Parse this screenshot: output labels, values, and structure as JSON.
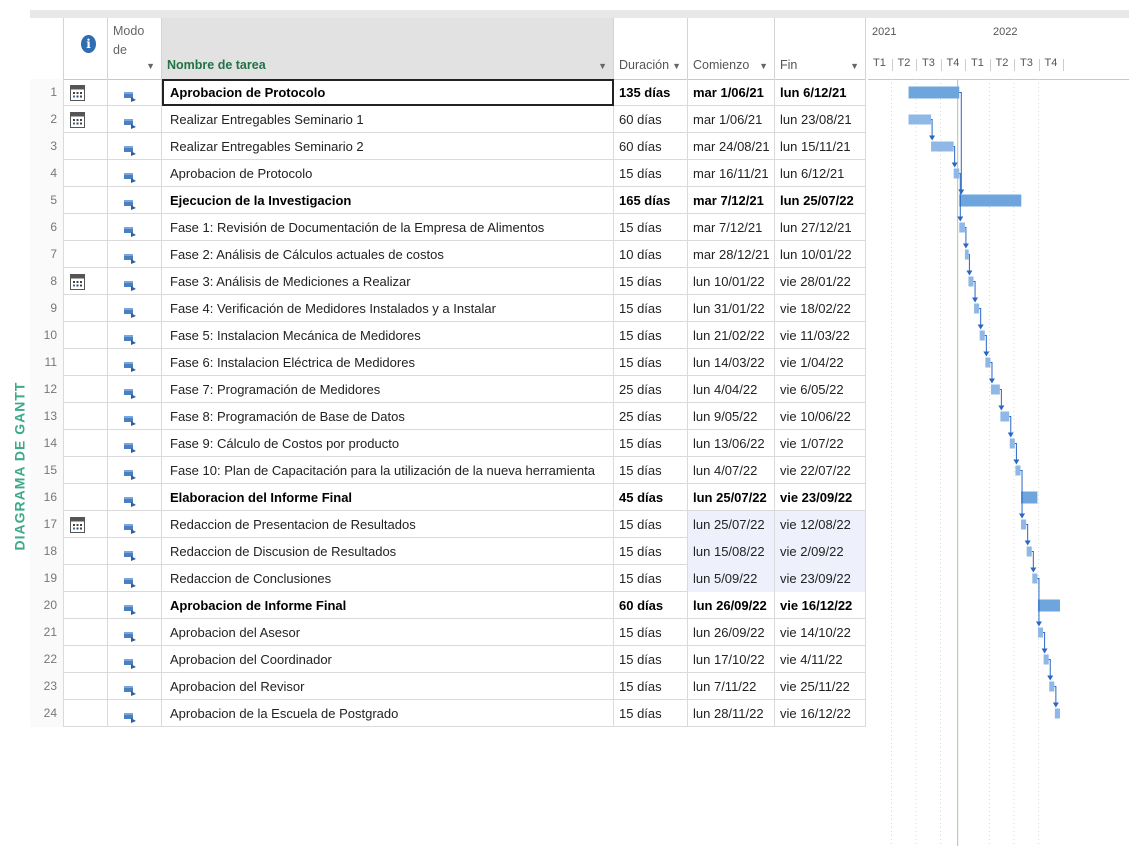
{
  "side_label": "DIAGRAMA DE GANTT",
  "header": {
    "info_icon": "info-icon",
    "modo_line1": "Modo",
    "modo_line2": "de",
    "task_name": "Nombre de tarea",
    "duration": "Duración",
    "start": "Comienzo",
    "finish": "Fin"
  },
  "timescale": {
    "years": [
      "2021",
      "2022"
    ],
    "quarters": [
      "T1",
      "T2",
      "T3",
      "T4",
      "T1",
      "T2",
      "T3",
      "T4"
    ]
  },
  "colors": {
    "bar": "#8fb8e6",
    "summary_bar": "#6fa5dd",
    "link": "#2a66c4",
    "today_line": "#9ccf9c",
    "side_label": "#3eaa8a",
    "task_header_text": "#217346"
  },
  "tasks": [
    {
      "id": "1",
      "cal": true,
      "summary": true,
      "name": "Aprobacion de Protocolo",
      "duration": "135 días",
      "start": "mar 1/06/21",
      "finish": "lun 6/12/21"
    },
    {
      "id": "2",
      "cal": true,
      "summary": false,
      "name": "Realizar Entregables Seminario 1",
      "duration": "60 días",
      "start": "mar 1/06/21",
      "finish": "lun 23/08/21"
    },
    {
      "id": "3",
      "cal": false,
      "summary": false,
      "name": "Realizar Entregables Seminario 2",
      "duration": "60 días",
      "start": "mar 24/08/21",
      "finish": "lun 15/11/21"
    },
    {
      "id": "4",
      "cal": false,
      "summary": false,
      "name": "Aprobacion de Protocolo",
      "duration": "15 días",
      "start": "mar 16/11/21",
      "finish": "lun 6/12/21"
    },
    {
      "id": "5",
      "cal": false,
      "summary": true,
      "name": "Ejecucion de la Investigacion",
      "duration": "165 días",
      "start": "mar 7/12/21",
      "finish": "lun 25/07/22"
    },
    {
      "id": "6",
      "cal": false,
      "summary": false,
      "name": "Fase 1: Revisión de Documentación de la Empresa de Alimentos",
      "duration": "15 días",
      "start": "mar 7/12/21",
      "finish": "lun 27/12/21"
    },
    {
      "id": "7",
      "cal": false,
      "summary": false,
      "name": "Fase 2: Análisis de Cálculos actuales de costos",
      "duration": "10 días",
      "start": "mar 28/12/21",
      "finish": "lun 10/01/22"
    },
    {
      "id": "8",
      "cal": true,
      "summary": false,
      "name": "Fase 3: Análisis de Mediciones a Realizar",
      "duration": "15 días",
      "start": "lun 10/01/22",
      "finish": "vie 28/01/22"
    },
    {
      "id": "9",
      "cal": false,
      "summary": false,
      "name": "Fase 4: Verificación de Medidores Instalados y a Instalar",
      "duration": "15 días",
      "start": "lun 31/01/22",
      "finish": "vie 18/02/22"
    },
    {
      "id": "10",
      "cal": false,
      "summary": false,
      "name": "Fase 5: Instalacion Mecánica de Medidores",
      "duration": "15 días",
      "start": "lun 21/02/22",
      "finish": "vie 11/03/22"
    },
    {
      "id": "11",
      "cal": false,
      "summary": false,
      "name": "Fase 6: Instalacion Eléctrica de Medidores",
      "duration": "15 días",
      "start": "lun 14/03/22",
      "finish": "vie 1/04/22"
    },
    {
      "id": "12",
      "cal": false,
      "summary": false,
      "name": "Fase 7: Programación de Medidores",
      "duration": "25 días",
      "start": "lun 4/04/22",
      "finish": "vie 6/05/22"
    },
    {
      "id": "13",
      "cal": false,
      "summary": false,
      "name": "Fase 8: Programación de Base de Datos",
      "duration": "25 días",
      "start": "lun 9/05/22",
      "finish": "vie 10/06/22"
    },
    {
      "id": "14",
      "cal": false,
      "summary": false,
      "name": "Fase 9: Cálculo de Costos por producto",
      "duration": "15 días",
      "start": "lun 13/06/22",
      "finish": "vie 1/07/22"
    },
    {
      "id": "15",
      "cal": false,
      "summary": false,
      "name": "Fase 10: Plan de Capacitación para la utilización de la nueva herramienta",
      "duration": "15 días",
      "start": "lun 4/07/22",
      "finish": "vie 22/07/22"
    },
    {
      "id": "16",
      "cal": false,
      "summary": true,
      "name": "Elaboracion del Informe Final",
      "duration": "45 días",
      "start": "lun 25/07/22",
      "finish": "vie 23/09/22"
    },
    {
      "id": "17",
      "cal": true,
      "summary": false,
      "name": "Redaccion de Presentacion de Resultados",
      "duration": "15 días",
      "start": "lun 25/07/22",
      "finish": "vie 12/08/22",
      "hl": true
    },
    {
      "id": "18",
      "cal": false,
      "summary": false,
      "name": "Redaccion de Discusion de Resultados",
      "duration": "15 días",
      "start": "lun 15/08/22",
      "finish": "vie 2/09/22",
      "hl": true
    },
    {
      "id": "19",
      "cal": false,
      "summary": false,
      "name": "Redaccion de Conclusiones",
      "duration": "15 días",
      "start": "lun 5/09/22",
      "finish": "vie 23/09/22",
      "hl": true
    },
    {
      "id": "20",
      "cal": false,
      "summary": true,
      "name": "Aprobacion de Informe Final",
      "duration": "60 días",
      "start": "lun 26/09/22",
      "finish": "vie 16/12/22"
    },
    {
      "id": "21",
      "cal": false,
      "summary": false,
      "name": "Aprobacion del Asesor",
      "duration": "15 días",
      "start": "lun 26/09/22",
      "finish": "vie 14/10/22"
    },
    {
      "id": "22",
      "cal": false,
      "summary": false,
      "name": "Aprobacion del Coordinador",
      "duration": "15 días",
      "start": "lun 17/10/22",
      "finish": "vie 4/11/22"
    },
    {
      "id": "23",
      "cal": false,
      "summary": false,
      "name": "Aprobacion del Revisor",
      "duration": "15 días",
      "start": "lun 7/11/22",
      "finish": "vie 25/11/22"
    },
    {
      "id": "24",
      "cal": false,
      "summary": false,
      "name": "Aprobacion de la Escuela de Postgrado",
      "duration": "15 días",
      "start": "lun 28/11/22",
      "finish": "vie 16/12/22"
    }
  ]
}
